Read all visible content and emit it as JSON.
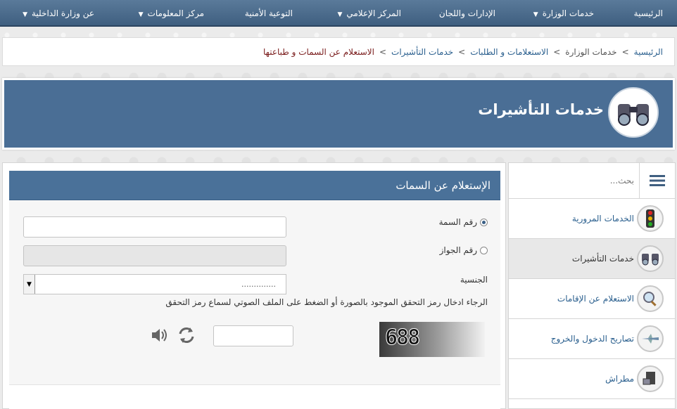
{
  "nav": {
    "items": [
      {
        "label": "الرئيسية",
        "has_menu": false
      },
      {
        "label": "خدمات الوزارة",
        "has_menu": true
      },
      {
        "label": "الإدارات واللجان",
        "has_menu": false
      },
      {
        "label": "المركز الإعلامي",
        "has_menu": true
      },
      {
        "label": "التوعية الأمنية",
        "has_menu": false
      },
      {
        "label": "مركز المعلومات",
        "has_menu": true
      },
      {
        "label": "عن وزارة الداخلية",
        "has_menu": true
      }
    ]
  },
  "breadcrumb": {
    "items": [
      "الرئيسية",
      "خدمات الوزارة",
      "الاستعلامات و الطلبات",
      "خدمات التأشيرات"
    ],
    "current": "الاستعلام عن السمات و طباعتها",
    "separator": ">"
  },
  "banner": {
    "title": "خدمات التأشيرات",
    "icon": "binoculars-icon"
  },
  "sidebar": {
    "search_placeholder": "بحث...",
    "items": [
      {
        "label": "الخدمات المرورية",
        "icon": "traffic-light-icon",
        "active": false
      },
      {
        "label": "خدمات التأشيرات",
        "icon": "binoculars-icon",
        "active": true
      },
      {
        "label": "الاستعلام عن الإقامات",
        "icon": "magnifier-icon",
        "active": false
      },
      {
        "label": "تصاريح الدخول والخروج",
        "icon": "airplane-icon",
        "active": false
      },
      {
        "label": "مطراش",
        "icon": "computer-icon",
        "active": false
      }
    ]
  },
  "panel": {
    "title": "الإستعلام عن السمات",
    "form": {
      "radio_visa_label": "رقم السمة",
      "radio_visa_selected": true,
      "visa_number_value": "",
      "radio_passport_label": "رقم الجواز",
      "radio_passport_selected": false,
      "passport_number_value": "",
      "nationality_label": "الجنسية",
      "nationality_value": "..............",
      "captcha_hint": "الرجاء ادخال رمز التحقق الموجود بالصورة أو الضغط على الملف الصوتي لسماع رمز التحقق",
      "captcha_code": "688",
      "captcha_input_value": ""
    }
  },
  "colors": {
    "nav_bg": "#4a6a8c",
    "banner_bg": "#4a6e95",
    "panel_head_bg": "#4a7199",
    "link": "#2a5f8e",
    "current_crumb": "#7a1c1c"
  }
}
